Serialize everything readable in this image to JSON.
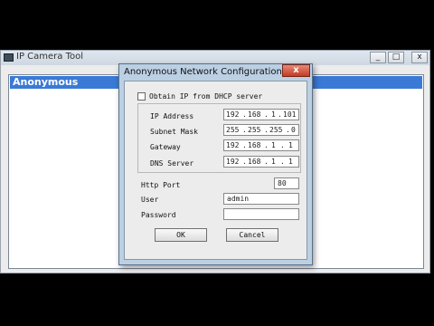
{
  "back_window": {
    "title": "IP Camera Tool",
    "list_item": "Anonymous",
    "sys_buttons": [
      "_",
      "□",
      "x"
    ]
  },
  "dialog": {
    "title": "Anonymous Network Configuration",
    "close_glyph": "x",
    "dhcp_label": "Obtain IP from DHCP server",
    "fields": {
      "ip_label": "IP Address",
      "ip": [
        "192",
        "168",
        "1",
        "101"
      ],
      "mask_label": "Subnet Mask",
      "mask": [
        "255",
        "255",
        "255",
        "0"
      ],
      "gateway_label": "Gateway",
      "gateway": [
        "192",
        "168",
        "1",
        "1"
      ],
      "dns_label": "DNS Server",
      "dns": [
        "192",
        "168",
        "1",
        "1"
      ],
      "http_port_label": "Http Port",
      "http_port": "80",
      "user_label": "User",
      "user": "admin",
      "password_label": "Password",
      "password": ""
    },
    "ok_label": "OK",
    "cancel_label": "Cancel"
  }
}
